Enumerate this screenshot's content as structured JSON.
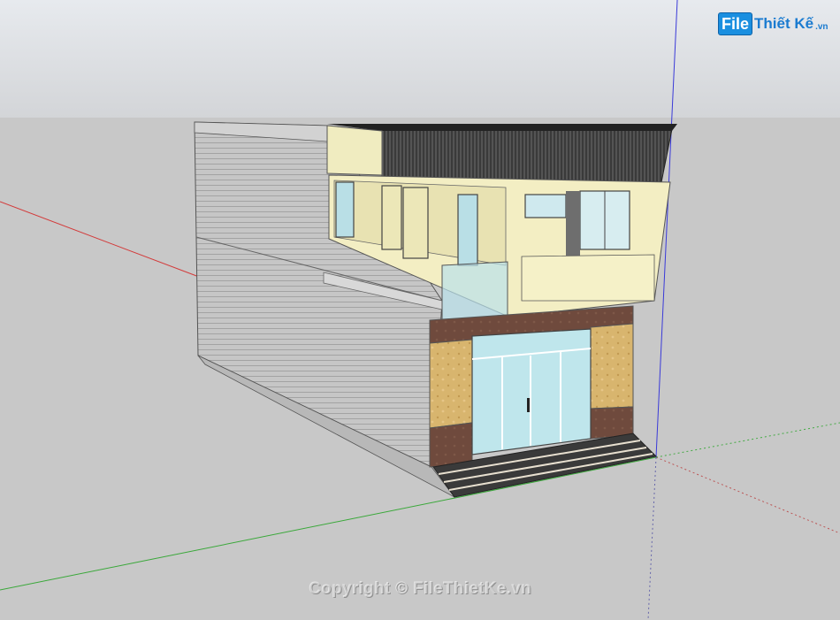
{
  "watermark": {
    "logo_badge": "File",
    "logo_name": "Thiết Kế",
    "logo_domain": ".vn",
    "copyright": "Copyright © FileThietKe.vn"
  },
  "colors": {
    "sky": "#e7eaee",
    "ground": "#c8c8c8",
    "axis_red": "#d33a3a",
    "axis_green": "#3aa83a",
    "axis_blue": "#3a3ad8",
    "wall_siding": "#c2c2c2",
    "facade_cream": "#f2eec4",
    "stone_tan": "#d9b36a",
    "brick_brown": "#6e4a3e",
    "glass": "#b9e3ea",
    "roof_dark": "#2e2e2e"
  }
}
